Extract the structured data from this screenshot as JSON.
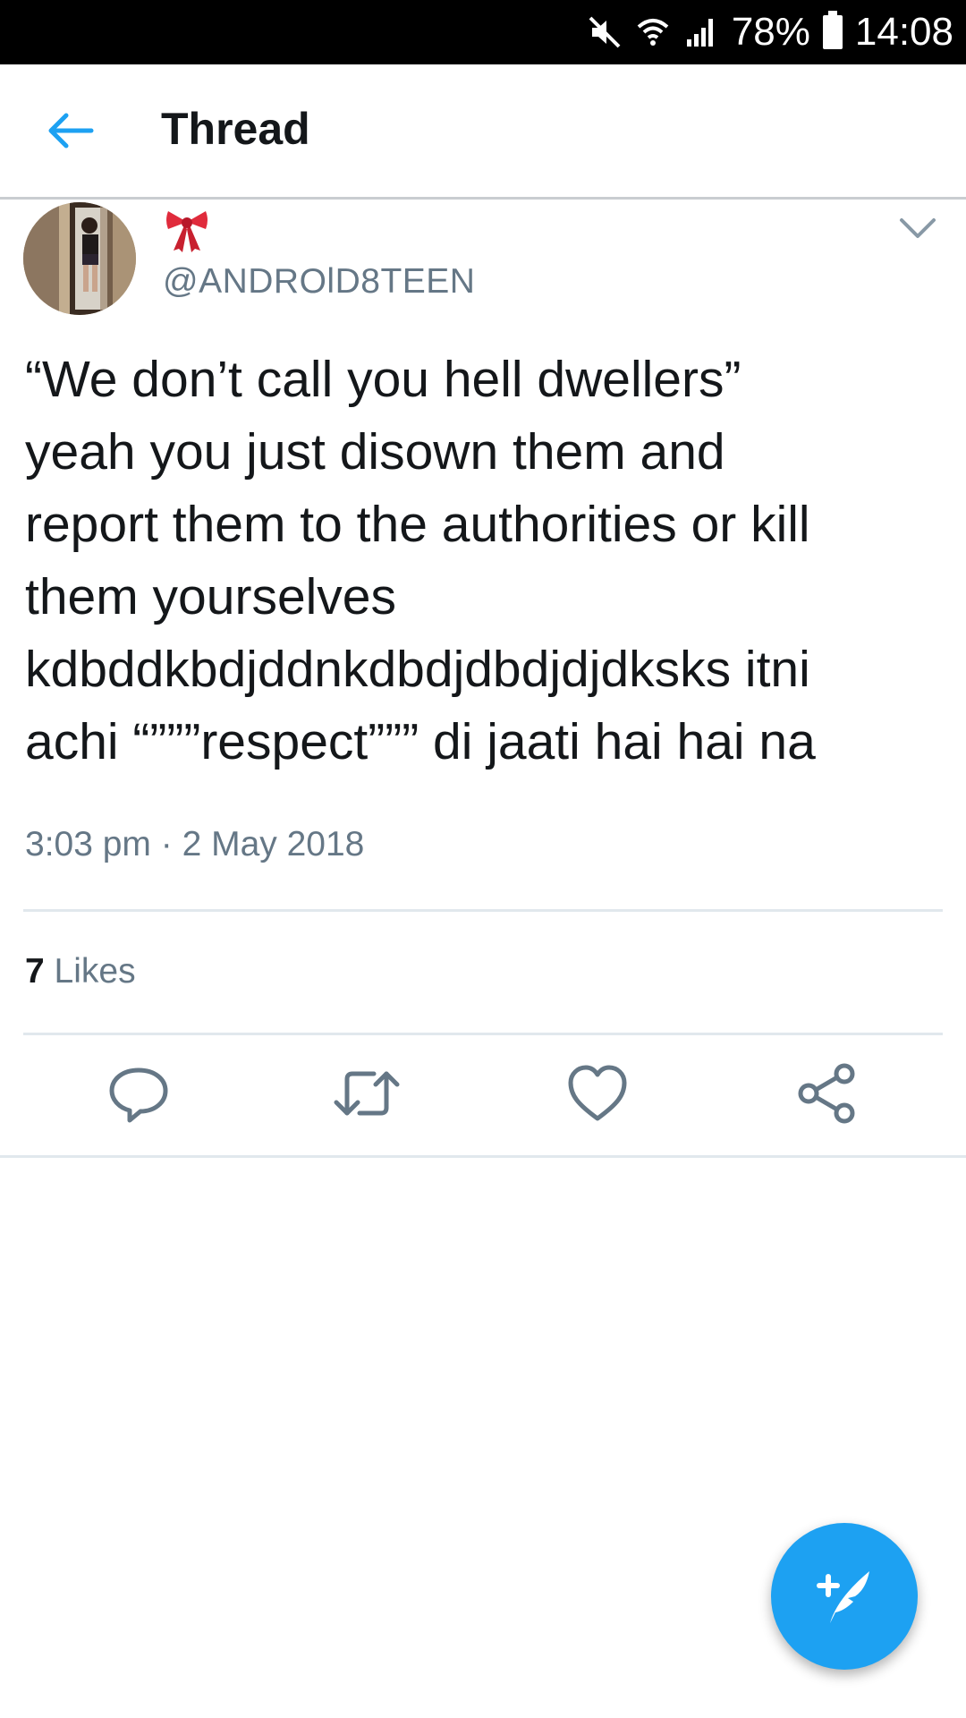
{
  "status_bar": {
    "battery": "78%",
    "time": "14:08",
    "icons": [
      "mute-icon",
      "wifi-icon",
      "signal-icon",
      "battery-icon"
    ]
  },
  "header": {
    "title": "Thread",
    "back_icon": "back-arrow-icon"
  },
  "tweet": {
    "display_name_emoji": "ribbon-bow-emoji",
    "handle": "@ANDROlD8TEEN",
    "lines": [
      "“We don’t call you hell dwellers”",
      "yeah you just disown them and",
      "report them to the authorities or kill",
      "them yourselves",
      "kdbddkbdjddnkdbdjdbdjdjdksks itni",
      "achi “”””respect””” di jaati hai hai na"
    ],
    "timestamp": "3:03 pm · 2 May 2018",
    "likes_count": "7",
    "likes_label": "Likes"
  },
  "actions": [
    "reply-icon",
    "retweet-icon",
    "like-icon",
    "share-icon"
  ],
  "fab": {
    "icon": "compose-tweet-icon"
  },
  "colors": {
    "accent": "#1da1f2",
    "text": "#14171a",
    "secondary_text": "#657786",
    "divider": "#e1e8ed"
  }
}
